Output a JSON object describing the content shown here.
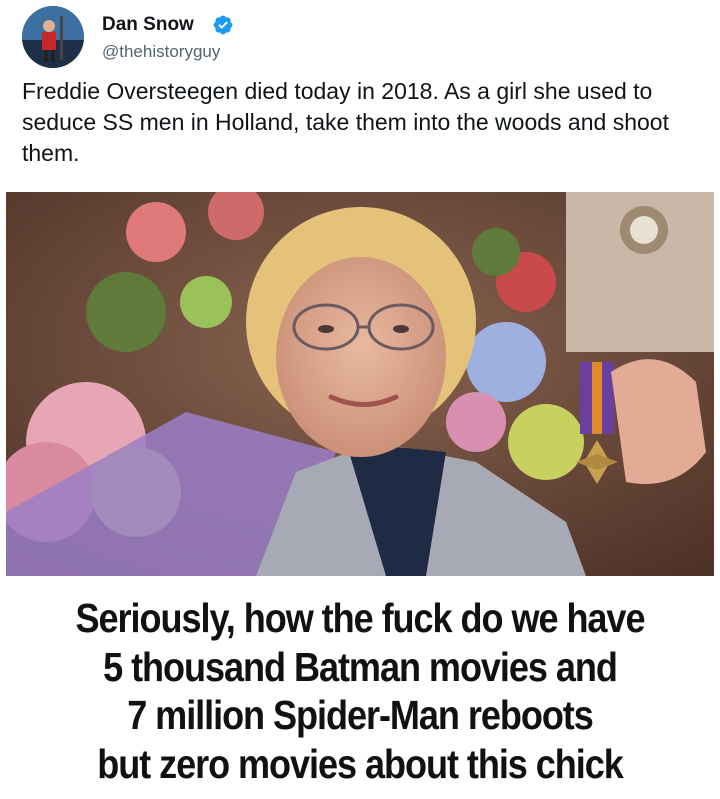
{
  "tweet": {
    "author_name": "Dan Snow",
    "author_handle": "@thehistoryguy",
    "verified": true,
    "verified_color": "#1d9bf0",
    "text": "Freddie Oversteegen died today in 2018. As a girl she used to seduce SS men in Holland, take them into the woods and shoot them."
  },
  "photo": {
    "subject": "elderly woman holding a medal beside flower bouquets",
    "icon": "photo-image"
  },
  "caption": {
    "lines": [
      "Seriously, how the fuck do we have",
      "5 thousand Batman movies and",
      "7 million Spider-Man reboots",
      "but zero movies about this chick"
    ]
  }
}
